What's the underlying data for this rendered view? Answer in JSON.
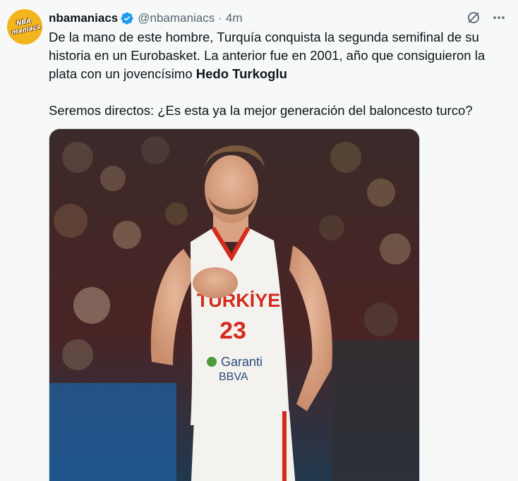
{
  "account": {
    "display_name": "nbamaniacs",
    "handle": "@nbamaniacs",
    "separator": "·",
    "time": "4m",
    "avatar_label": "NBA maniacs"
  },
  "icons": {
    "verified": "verified-badge-icon",
    "grok": "grok-icon",
    "more": "more-options-icon"
  },
  "colors": {
    "verified": "#1d9bf0",
    "secondary_text": "#536471",
    "jersey_red": "#d52b1e"
  },
  "tweet": {
    "text_part1": "De la mano de este hombre, Turquía conquista la segunda semifinal de su historia en un Eurobasket. La anterior fue en 2001, año que consiguieron la plata con un jovencísimo ",
    "text_bold": "Hedo Turkoglu",
    "text_part2": "Seremos directos: ¿Es esta ya la mejor generación del baloncesto turco?"
  },
  "media": {
    "jersey_country": "TÜRKİYE",
    "jersey_number": "23",
    "sponsor_line1": "Garanti",
    "sponsor_line2": "BBVA"
  }
}
